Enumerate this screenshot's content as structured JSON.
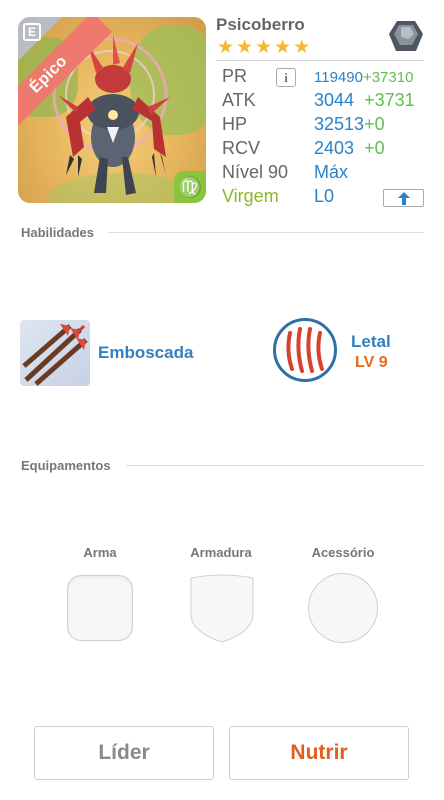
{
  "monster": {
    "name": "Psicoberro",
    "rarity": "Épico",
    "stars": 5,
    "element_icon": "virgo-glyph-icon",
    "element_symbol": "♍",
    "corner_symbol": "E"
  },
  "stats": {
    "pr_label": "PR",
    "pr_value": "119490",
    "pr_bonus": "+37310",
    "atk_label": "ATK",
    "atk_value": "3044",
    "atk_bonus": "+3731",
    "hp_label": "HP",
    "hp_value": "32513",
    "hp_bonus": "+0",
    "rcv_label": "RCV",
    "rcv_value": "2403",
    "rcv_bonus": "+0",
    "level_label": "Nível 90",
    "level_value": "Máx",
    "sign_label": "Virgem",
    "sign_value": "L0",
    "info_glyph": "i",
    "upgrade_glyph": "⬆"
  },
  "sections": {
    "skills": "Habilidades",
    "equipment": "Equipamentos"
  },
  "skill": {
    "name": "Emboscada",
    "icon": "arrows-icon"
  },
  "leader_skill": {
    "name": "Letal",
    "level": "LV 9",
    "icon": "claw-marks-icon"
  },
  "equipment": {
    "weapon": "Arma",
    "armor": "Armadura",
    "accessory": "Acessório"
  },
  "buttons": {
    "leader": "Líder",
    "feed": "Nutrir"
  },
  "colors": {
    "accent_blue": "#2a82c8",
    "bonus_green": "#5ec04c",
    "ribbon_red": "#ee7a6e",
    "feed_orange": "#e15e1f",
    "star_gold": "#f5b82e"
  }
}
